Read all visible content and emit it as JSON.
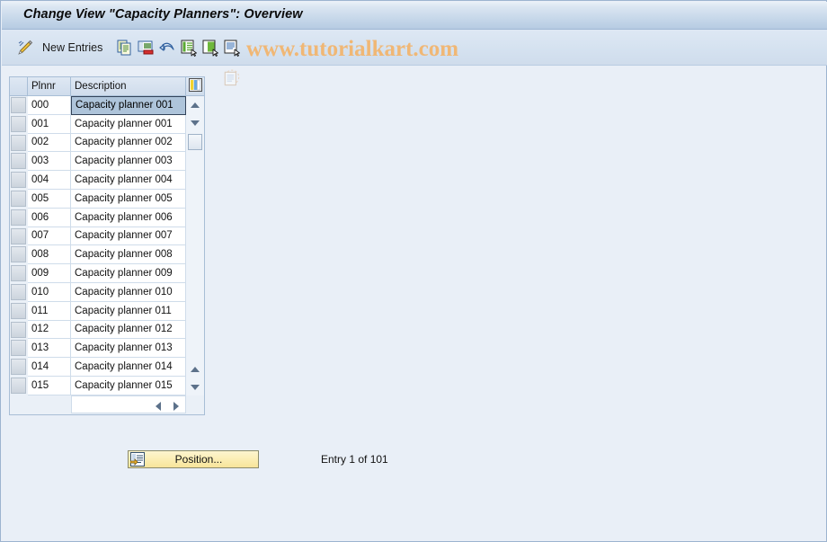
{
  "window": {
    "title": "Change View \"Capacity Planners\": Overview"
  },
  "toolbar": {
    "edit_icon": "pencil-icon",
    "new_entries_label": "New Entries",
    "buttons": [
      {
        "icon": "copy-icon",
        "tooltip": "Copy As..."
      },
      {
        "icon": "delete-row-icon",
        "tooltip": "Delete"
      },
      {
        "icon": "undo-icon",
        "tooltip": "Undo Change"
      },
      {
        "icon": "select-all-icon",
        "tooltip": "Select All"
      },
      {
        "icon": "deselect-all-icon",
        "tooltip": "Deselect All"
      },
      {
        "icon": "details-icon",
        "tooltip": "Details"
      }
    ]
  },
  "watermark": {
    "text": "www.tutorialkart.com",
    "color": "#f0b775",
    "icon": "document-watermark-icon"
  },
  "table": {
    "column_config_icon": "column-config-icon",
    "columns": [
      "",
      "Plnnr",
      "Description",
      ""
    ],
    "selected_row_index": 0,
    "selected_column": "Description",
    "rows": [
      {
        "plnnr": "000",
        "description": "Capacity planner 001"
      },
      {
        "plnnr": "001",
        "description": "Capacity planner 001"
      },
      {
        "plnnr": "002",
        "description": "Capacity planner 002"
      },
      {
        "plnnr": "003",
        "description": "Capacity planner 003"
      },
      {
        "plnnr": "004",
        "description": "Capacity planner 004"
      },
      {
        "plnnr": "005",
        "description": "Capacity planner 005"
      },
      {
        "plnnr": "006",
        "description": "Capacity planner 006"
      },
      {
        "plnnr": "007",
        "description": "Capacity planner 007"
      },
      {
        "plnnr": "008",
        "description": "Capacity planner 008"
      },
      {
        "plnnr": "009",
        "description": "Capacity planner 009"
      },
      {
        "plnnr": "010",
        "description": "Capacity planner 010"
      },
      {
        "plnnr": "011",
        "description": "Capacity planner 011"
      },
      {
        "plnnr": "012",
        "description": "Capacity planner 012"
      },
      {
        "plnnr": "013",
        "description": "Capacity planner 013"
      },
      {
        "plnnr": "014",
        "description": "Capacity planner 014"
      },
      {
        "plnnr": "015",
        "description": "Capacity planner 015"
      }
    ]
  },
  "footer": {
    "position_button_label": "Position...",
    "position_button_icon": "position-icon",
    "entry_status": "Entry 1 of 101"
  },
  "colors": {
    "title_bar_start": "#eaf1f8",
    "title_bar_end": "#b6cbe2",
    "page_background": "#e9eff7",
    "selection_blue": "#aec4da",
    "button_yellow": "#fbeeb4",
    "watermark_orange": "#f0b775"
  }
}
